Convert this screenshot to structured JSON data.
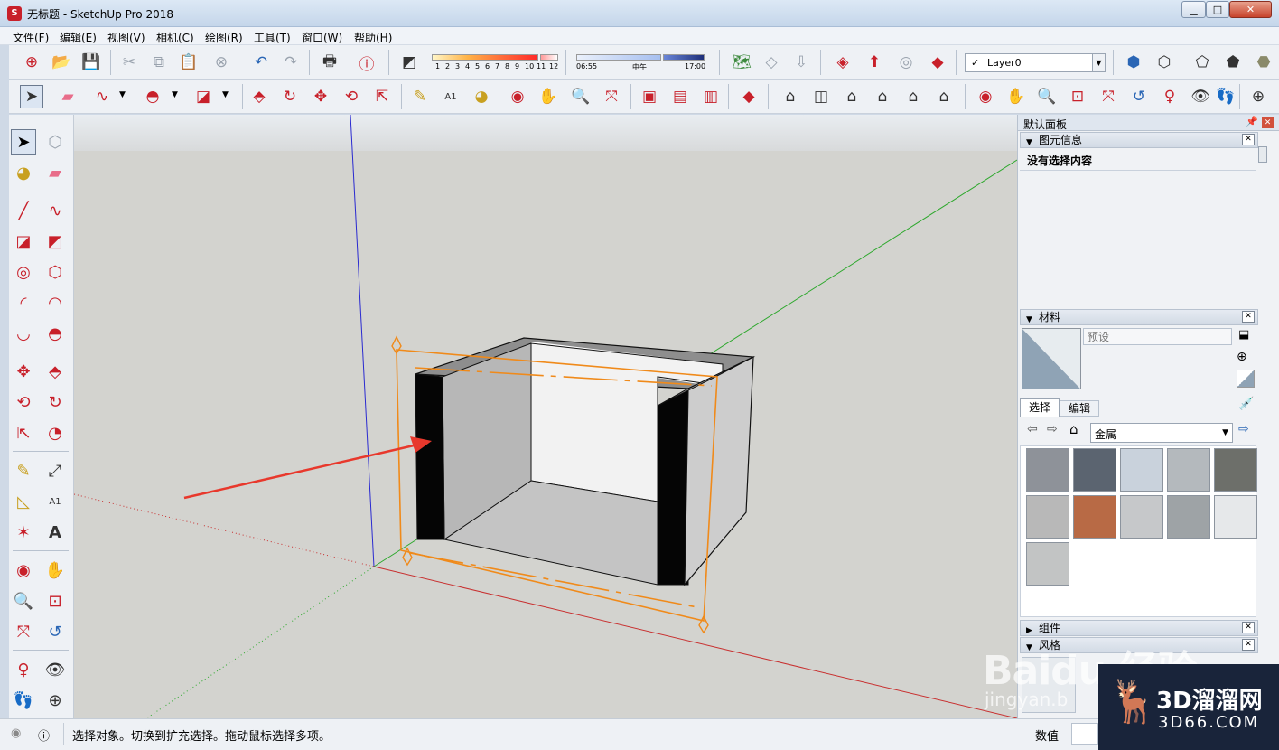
{
  "window": {
    "title": "无标题 - SketchUp Pro 2018",
    "min_label": "▁",
    "max_label": "□",
    "close_label": "✕"
  },
  "menu": [
    "文件(F)",
    "编辑(E)",
    "视图(V)",
    "相机(C)",
    "绘图(R)",
    "工具(T)",
    "窗口(W)",
    "帮助(H)"
  ],
  "toolbar": {
    "shadow_months": [
      "1",
      "2",
      "3",
      "4",
      "5",
      "6",
      "7",
      "8",
      "9",
      "10",
      "11",
      "12"
    ],
    "time_start": "06:55",
    "time_mid": "中午",
    "time_end": "17:00",
    "layer_value": "Layer0",
    "layer_check": "✓"
  },
  "right_panel": {
    "title": "默认面板",
    "entity_info": {
      "header": "图元信息",
      "no_selection": "没有选择内容"
    },
    "materials": {
      "header": "材料",
      "name_placeholder": "预设",
      "tab_select": "选择",
      "tab_edit": "编辑",
      "library": "金属",
      "swatch_colors": [
        "#8e9299",
        "#5b6470",
        "#c9d2dc",
        "#b4b9bd",
        "#6d6f6a",
        "#b8b8b8",
        "#b86a45",
        "#c6c8ca",
        "#9ea3a6",
        "#e6e8ea",
        "#c2c4c4"
      ]
    },
    "components_header": "组件",
    "styles_header": "风格"
  },
  "status": {
    "message": "选择对象。切换到扩充选择。拖动鼠标选择多项。",
    "value_label": "数值"
  },
  "watermark": {
    "baidu": "Baidu 经验",
    "jingyan": "jingyan.b",
    "brand": "3D溜溜网",
    "site": "3D66.COM"
  }
}
